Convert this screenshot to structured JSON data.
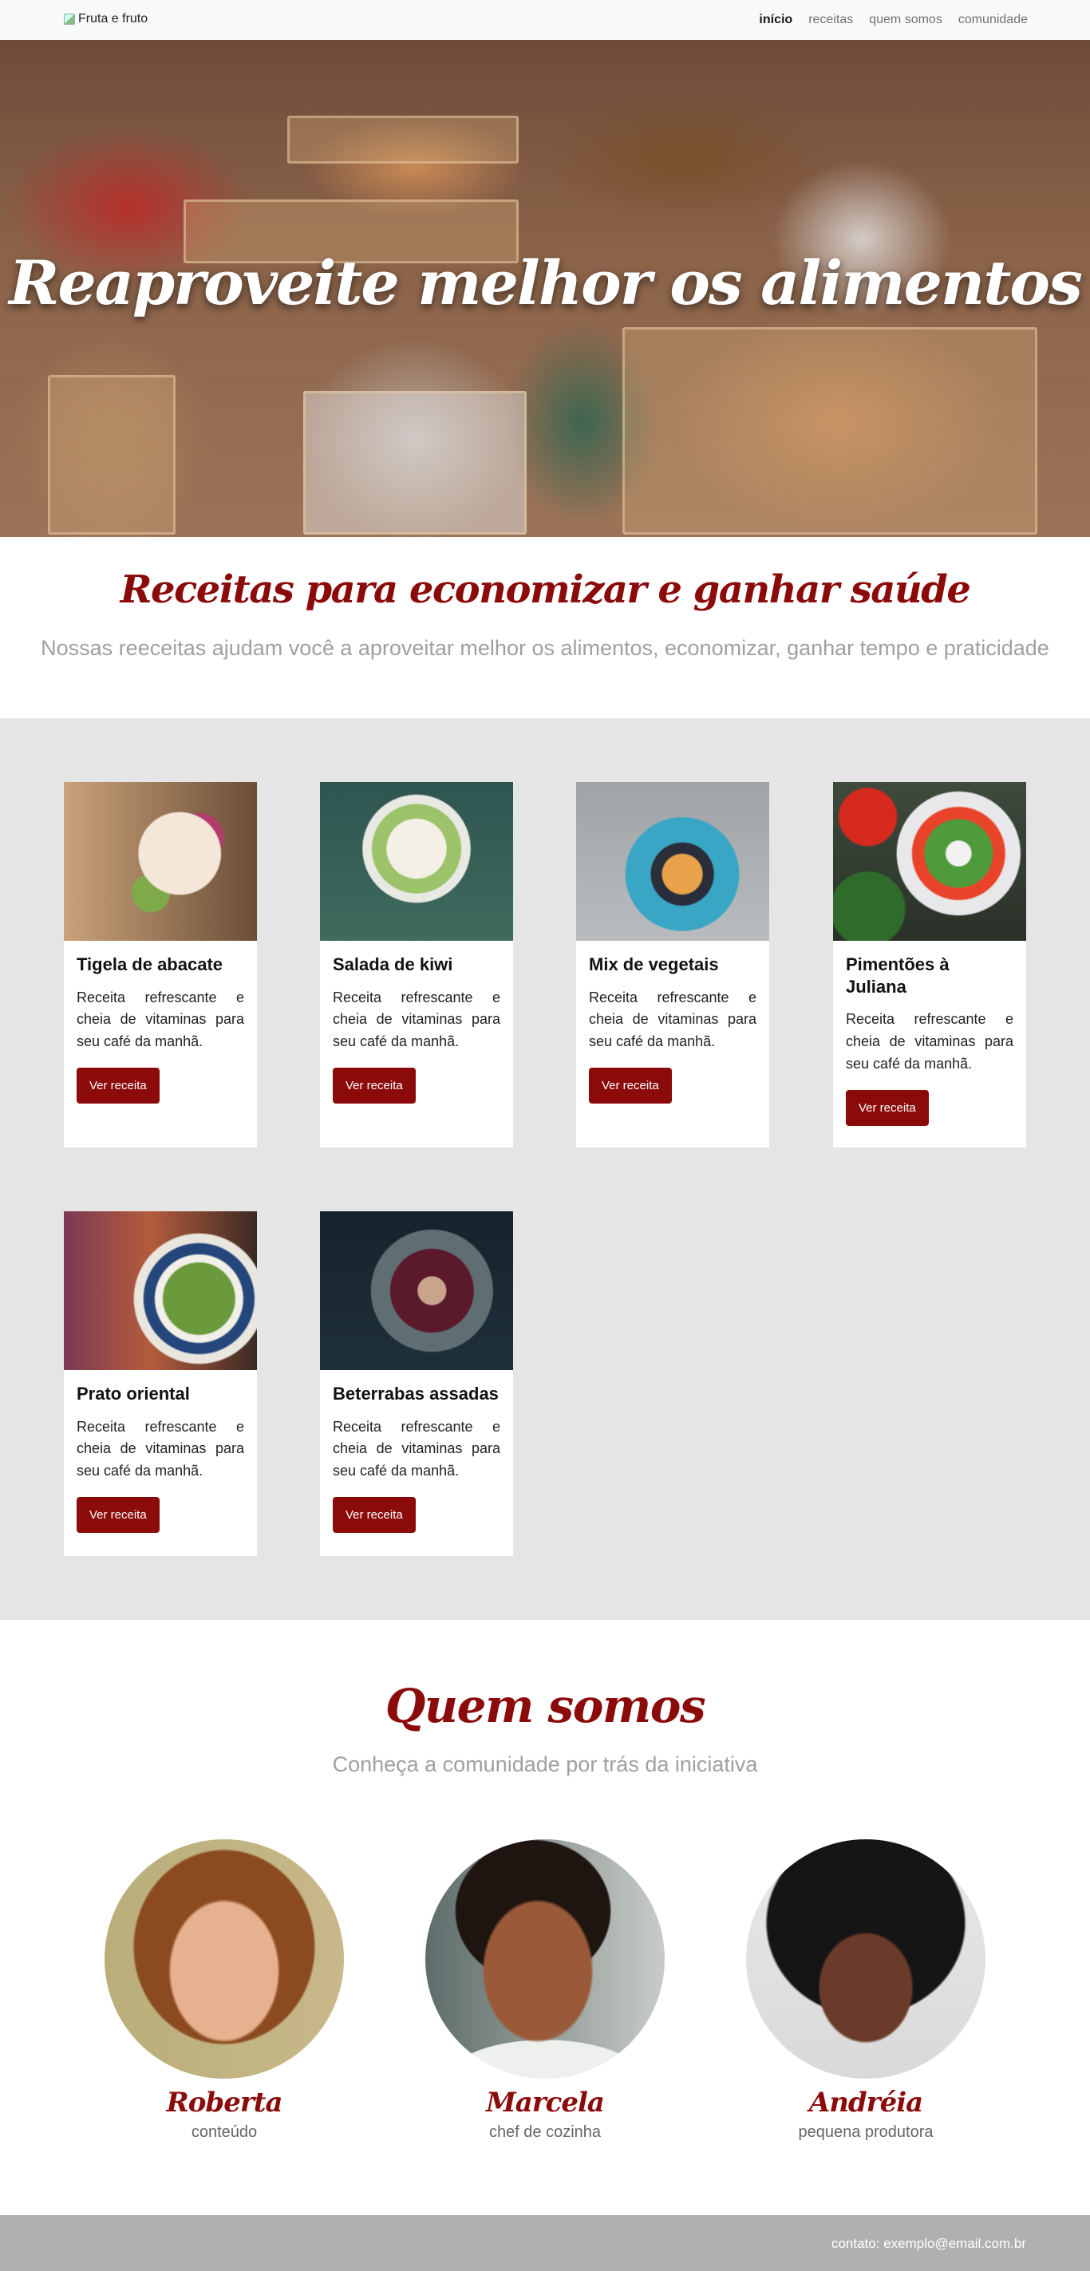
{
  "nav": {
    "brand_alt": "Fruta e fruto",
    "links": [
      {
        "label": "início",
        "active": true
      },
      {
        "label": "receitas",
        "active": false
      },
      {
        "label": "quem somos",
        "active": false
      },
      {
        "label": "comunidade",
        "active": false
      }
    ]
  },
  "hero": {
    "title": "Reaproveite melhor os alimentos"
  },
  "intro": {
    "title": "Receitas para economizar e ganhar saúde",
    "subtitle": "Nossas reeceitas ajudam você a aproveitar melhor os alimentos, economizar, ganhar tempo e praticidade"
  },
  "recipes": [
    {
      "title": "Tigela de abacate",
      "text": "Receita refrescante e cheia de vitaminas para seu café da manhã.",
      "button": "Ver receita"
    },
    {
      "title": "Salada de kiwi",
      "text": "Receita refrescante e cheia de vitaminas para seu café da manhã.",
      "button": "Ver receita"
    },
    {
      "title": "Mix de vegetais",
      "text": "Receita refrescante e cheia de vitaminas para seu café da manhã.",
      "button": "Ver receita"
    },
    {
      "title": "Pimentões à Juliana",
      "text": "Receita refrescante e cheia de vitaminas para seu café da manhã.",
      "button": "Ver receita"
    },
    {
      "title": "Prato oriental",
      "text": "Receita refrescante e cheia de vitaminas para seu café da manhã.",
      "button": "Ver receita"
    },
    {
      "title": "Beterrabas assadas",
      "text": "Receita refrescante e cheia de vitaminas para seu café da manhã.",
      "button": "Ver receita"
    }
  ],
  "about": {
    "title": "Quem somos",
    "subtitle": "Conheça a comunidade por trás da iniciativa",
    "people": [
      {
        "name": "Roberta",
        "role": "conteúdo"
      },
      {
        "name": "Marcela",
        "role": "chef de cozinha"
      },
      {
        "name": "Andréia",
        "role": "pequena produtora"
      }
    ]
  },
  "footer": {
    "contact": "contato: exemplo@email.com.br"
  },
  "colors": {
    "accent": "#8b0a0a",
    "section_bg": "#e5e5e5",
    "footer_bg": "#b0b0b0",
    "nav_bg": "#f8f9fa"
  }
}
